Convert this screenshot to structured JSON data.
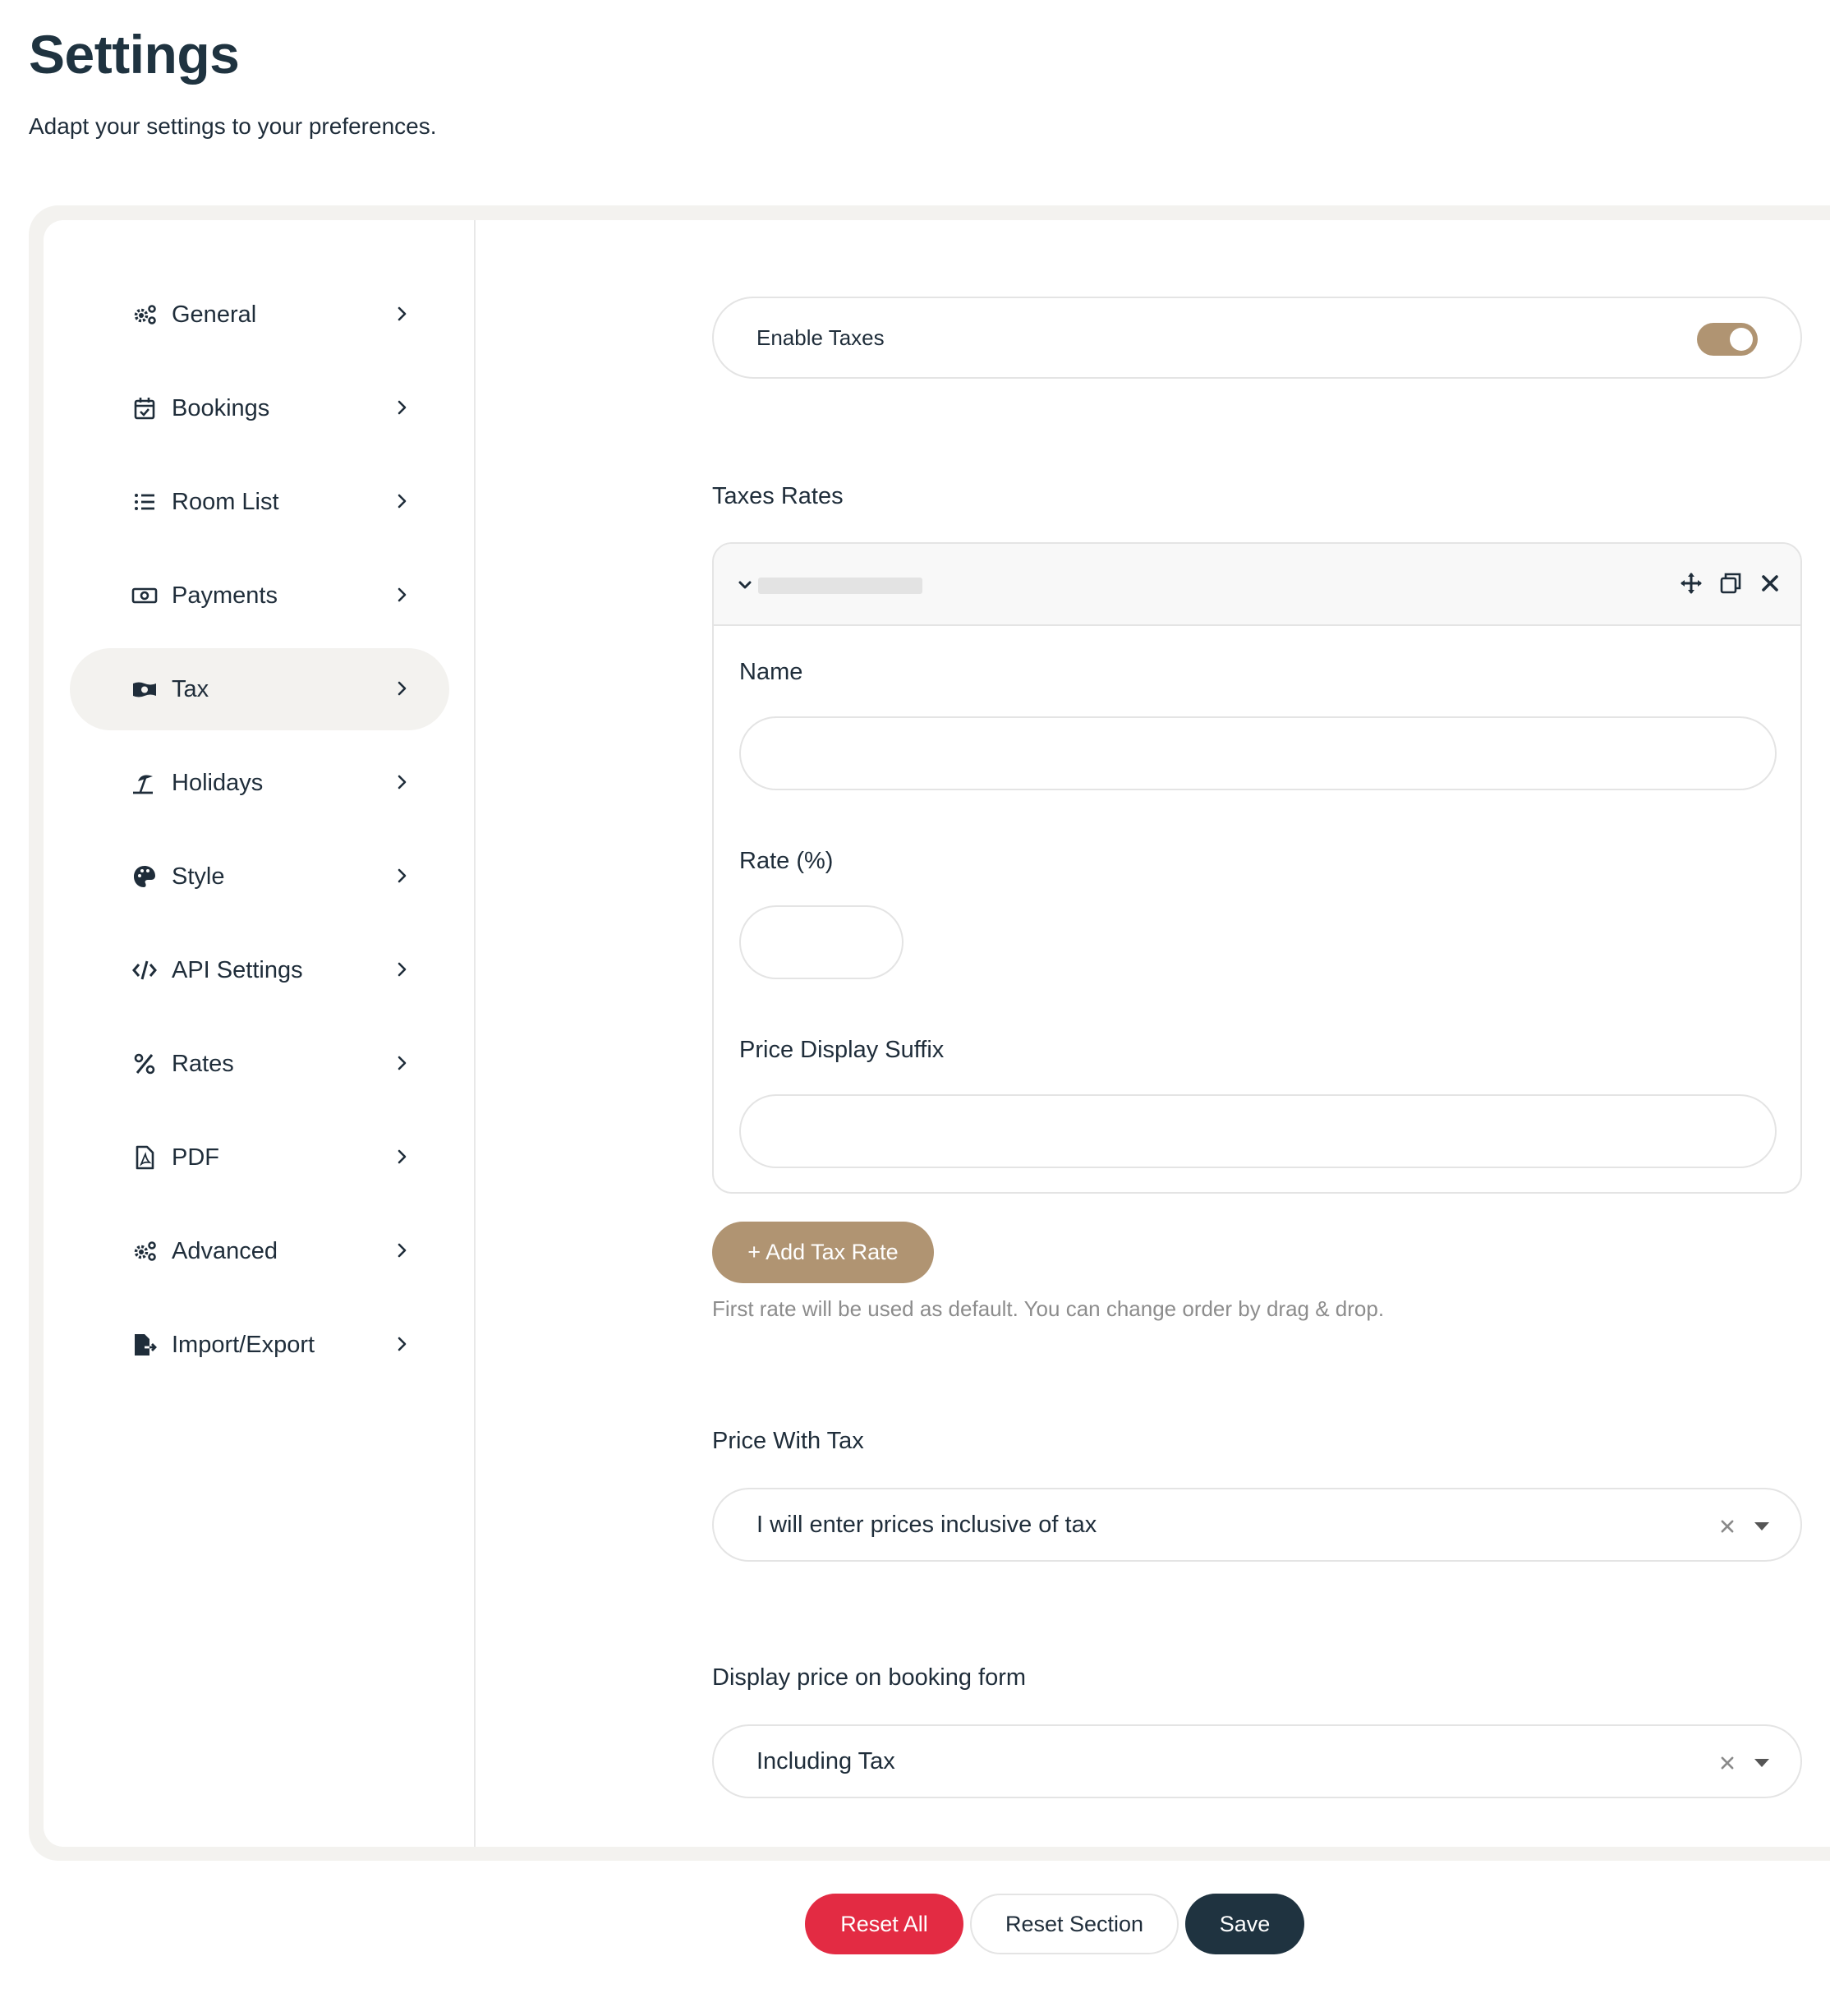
{
  "header": {
    "title": "Settings",
    "subtitle": "Adapt your settings to your preferences."
  },
  "sidebar": {
    "items": [
      {
        "label": "General",
        "icon": "gears-icon"
      },
      {
        "label": "Bookings",
        "icon": "calendar-check-icon"
      },
      {
        "label": "Room List",
        "icon": "list-icon"
      },
      {
        "label": "Payments",
        "icon": "money-bill-icon"
      },
      {
        "label": "Tax",
        "icon": "money-bill-wave-icon",
        "active": true
      },
      {
        "label": "Holidays",
        "icon": "umbrella-beach-icon"
      },
      {
        "label": "Style",
        "icon": "palette-icon"
      },
      {
        "label": "API Settings",
        "icon": "code-icon"
      },
      {
        "label": "Rates",
        "icon": "percent-icon"
      },
      {
        "label": "PDF",
        "icon": "file-pdf-icon"
      },
      {
        "label": "Advanced",
        "icon": "gears-icon"
      },
      {
        "label": "Import/Export",
        "icon": "file-export-icon"
      }
    ]
  },
  "main": {
    "enable_taxes": {
      "label": "Enable Taxes",
      "enabled": true
    },
    "tax_rates": {
      "label": "Taxes Rates",
      "row": {
        "name_label": "Name",
        "name_value": "",
        "rate_label": "Rate (%)",
        "rate_value": "",
        "suffix_label": "Price Display Suffix",
        "suffix_value": ""
      },
      "add_button": "+ Add Tax Rate",
      "help": "First rate will be used as default. You can change order by drag & drop."
    },
    "price_with_tax": {
      "label": "Price With Tax",
      "value": "I will enter prices inclusive of tax"
    },
    "display_price": {
      "label": "Display price on booking form",
      "value": "Including Tax"
    }
  },
  "footer": {
    "reset_all": "Reset All",
    "reset_section": "Reset Section",
    "save": "Save"
  },
  "colors": {
    "accent": "#b09472",
    "danger": "#e32b43",
    "dark": "#1f3340",
    "active_bg": "#f3f2ef"
  }
}
